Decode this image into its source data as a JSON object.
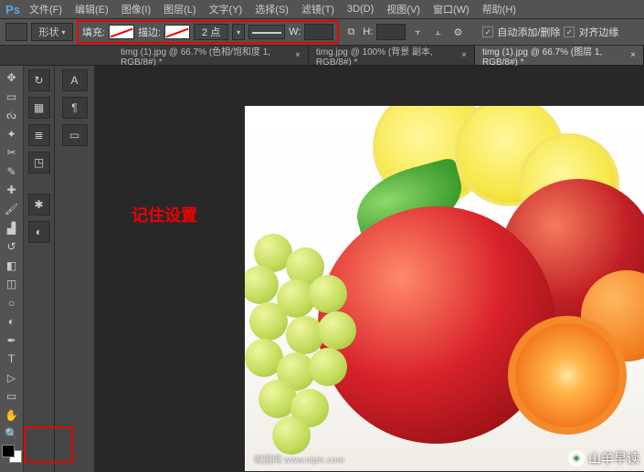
{
  "app": {
    "logo": "Ps"
  },
  "menu": {
    "file": "文件(F)",
    "edit": "编辑(E)",
    "image": "图像(I)",
    "layer": "图层(L)",
    "type": "文字(Y)",
    "select": "选择(S)",
    "filter": "滤镜(T)",
    "threeD": "3D(D)",
    "view": "视图(V)",
    "window": "窗口(W)",
    "help": "帮助(H)"
  },
  "options": {
    "shape_mode": "形状",
    "fill_label": "填充:",
    "stroke_label": "描边:",
    "stroke_width": "2 点",
    "w_label": "W:",
    "h_label": "H:",
    "w_value": "",
    "h_value": "",
    "auto_add_delete": "自动添加/删除",
    "align_edges": "对齐边缘",
    "checked": "✓"
  },
  "tabs": [
    {
      "label": "timg (1).jpg @ 66.7% (色相/饱和度 1, RGB/8#) *",
      "active": false
    },
    {
      "label": "timg.jpg @ 100% (背景 副本, RGB/8#) *",
      "active": false
    },
    {
      "label": "timg (1).jpg @ 66.7% (图层 1, RGB/8#) *",
      "active": true
    }
  ],
  "annotation": {
    "text": "记住设置"
  },
  "watermark": {
    "bl_a": "昵图网",
    "bl_b": "www.nipic.com",
    "br": "山羊早读"
  },
  "icons": {
    "move": "✥",
    "marquee": "▭",
    "lasso": "ᔔ",
    "wand": "✦",
    "crop": "✂",
    "eyedrop": "✎",
    "heal": "✚",
    "brush": "🖌",
    "stamp": "▟",
    "history": "↺",
    "eraser": "◧",
    "gradient": "◫",
    "blur": "○",
    "dodge": "◐",
    "pen": "✒",
    "text": "T",
    "path": "▷",
    "shape": "▭",
    "hand": "✋",
    "zoom": "🔍",
    "link": "⧉",
    "align1": "⫟",
    "align2": "⫠",
    "gear": "⚙",
    "history_p": "↻",
    "swatch_p": "▦",
    "layers_p": "≣",
    "paths_p": "◳",
    "styles_p": "✱",
    "adjust_p": "◐",
    "char_p": "A",
    "para_p": "¶",
    "shape_p": "▭",
    "close": "×",
    "dd": "▾"
  }
}
